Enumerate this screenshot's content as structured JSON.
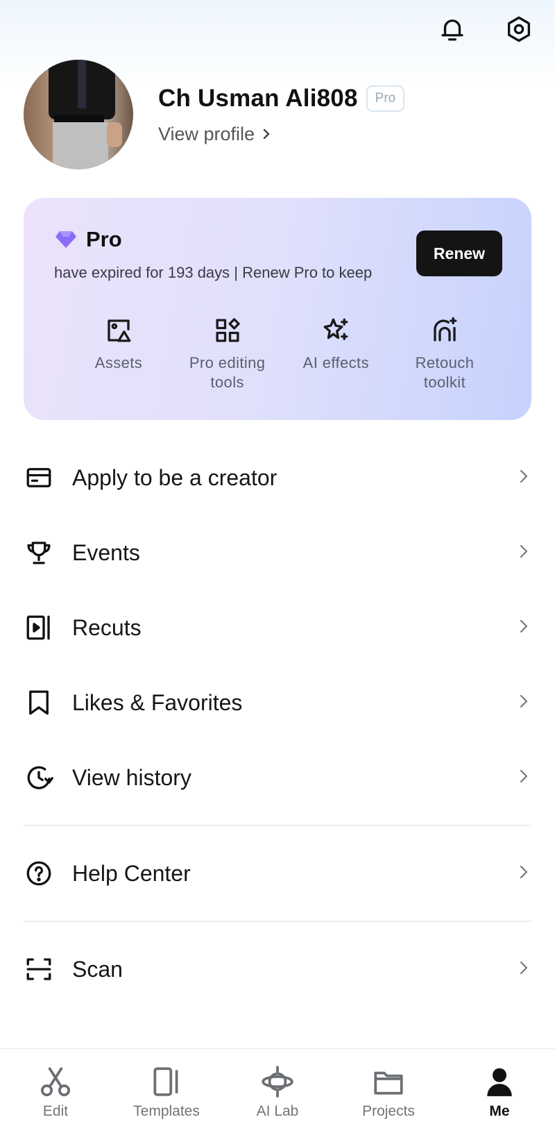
{
  "header": {
    "notification_icon": "bell-icon",
    "settings_icon": "gear-hex-icon"
  },
  "profile": {
    "name": "Ch Usman Ali808",
    "badge": "Pro",
    "view_profile": "View profile"
  },
  "pro_card": {
    "title": "Pro",
    "description": "have expired for 193 days | Renew Pro to keep",
    "renew_label": "Renew",
    "features": [
      {
        "label": "Assets",
        "icon": "assets-icon"
      },
      {
        "label": "Pro editing tools",
        "icon": "grid-icon"
      },
      {
        "label": "AI effects",
        "icon": "sparkle-icon"
      },
      {
        "label": "Retouch toolkit",
        "icon": "retouch-icon"
      }
    ]
  },
  "menu": {
    "items": [
      {
        "label": "Apply to be a creator",
        "icon": "card-icon"
      },
      {
        "label": "Events",
        "icon": "trophy-icon"
      },
      {
        "label": "Recuts",
        "icon": "play-frame-icon"
      },
      {
        "label": "Likes & Favorites",
        "icon": "bookmark-icon"
      },
      {
        "label": "View history",
        "icon": "history-icon"
      },
      {
        "label": "Help Center",
        "icon": "help-icon"
      },
      {
        "label": "Scan",
        "icon": "scan-icon"
      }
    ]
  },
  "tabs": [
    {
      "label": "Edit",
      "icon": "scissors-icon",
      "active": false
    },
    {
      "label": "Templates",
      "icon": "templates-icon",
      "active": false
    },
    {
      "label": "AI Lab",
      "icon": "ai-lab-icon",
      "active": false
    },
    {
      "label": "Projects",
      "icon": "folder-icon",
      "active": false
    },
    {
      "label": "Me",
      "icon": "person-icon",
      "active": true
    }
  ],
  "colors": {
    "accent_purple": "#8b6cf6",
    "renew_bg": "#141414",
    "card_gradient_start": "#ece2fb",
    "card_gradient_end": "#c6d2fd"
  }
}
